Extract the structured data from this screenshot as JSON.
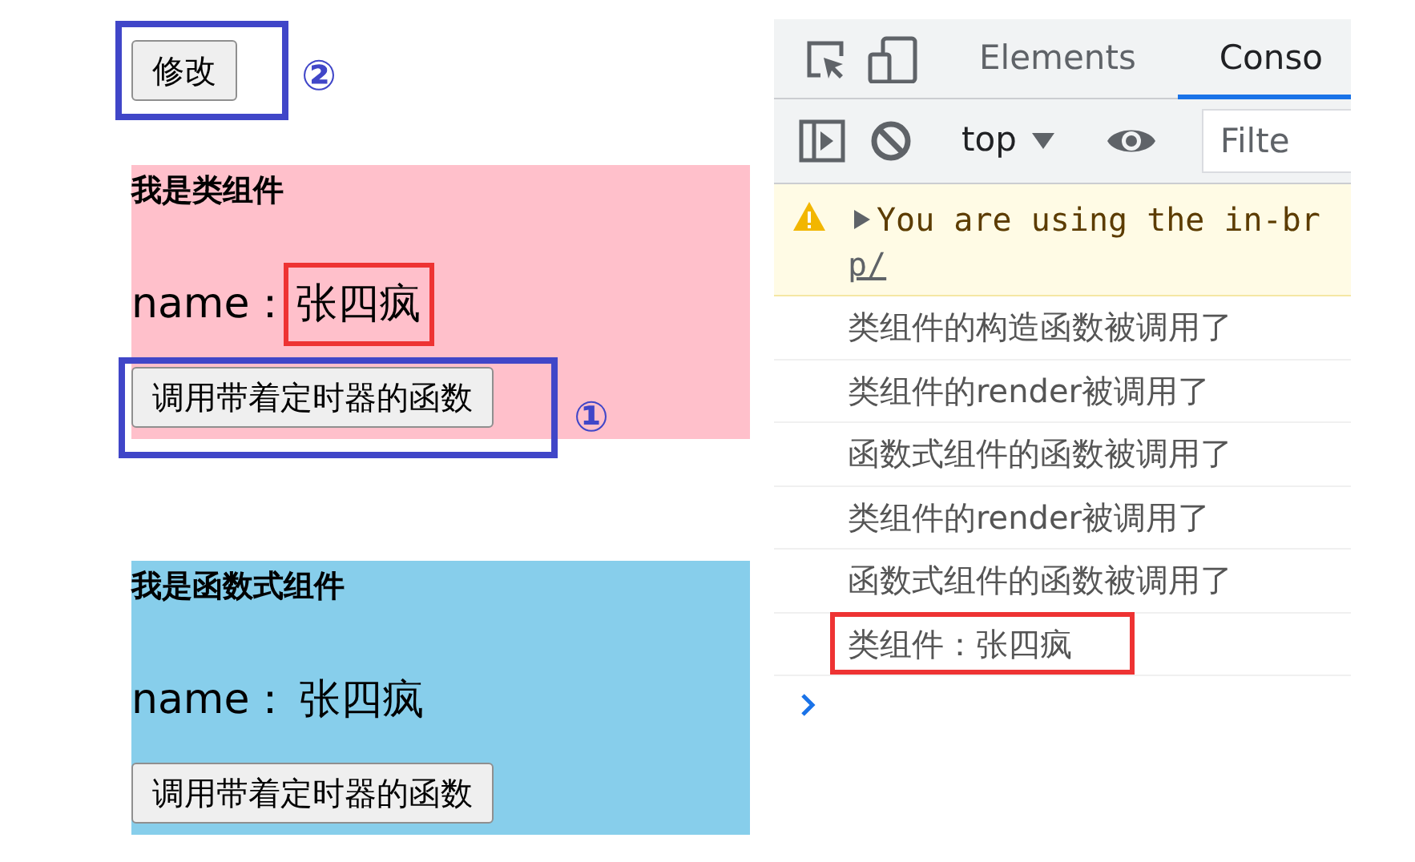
{
  "modify_button": "修改",
  "components": [
    {
      "title": "我是类组件",
      "name_label": "name：",
      "name_value": "张四疯",
      "button": "调用带着定时器的函数",
      "kind": "class",
      "highlighted": true
    },
    {
      "title": "我是函数式组件",
      "name_label": "name：",
      "name_value": "张四疯",
      "button": "调用带着定时器的函数",
      "kind": "function",
      "highlighted": false
    }
  ],
  "markers": {
    "modify": "②",
    "timer": "①"
  },
  "devtools": {
    "tabs": [
      {
        "label": "Elements",
        "selected": false
      },
      {
        "label": "Conso",
        "selected": true
      }
    ],
    "context": "top",
    "filter_placeholder": "Filte",
    "warning": {
      "text": "You are using the in-br",
      "link": "p/"
    },
    "messages": [
      {
        "text": "类组件的构造函数被调用了",
        "highlighted": false
      },
      {
        "text": "类组件的render被调用了",
        "highlighted": false
      },
      {
        "text": "函数式组件的函数被调用了",
        "highlighted": false
      },
      {
        "text": "类组件的render被调用了",
        "highlighted": false
      },
      {
        "text": "函数式组件的函数被调用了",
        "highlighted": false
      },
      {
        "text": "类组件：张四疯",
        "highlighted": true
      }
    ]
  }
}
